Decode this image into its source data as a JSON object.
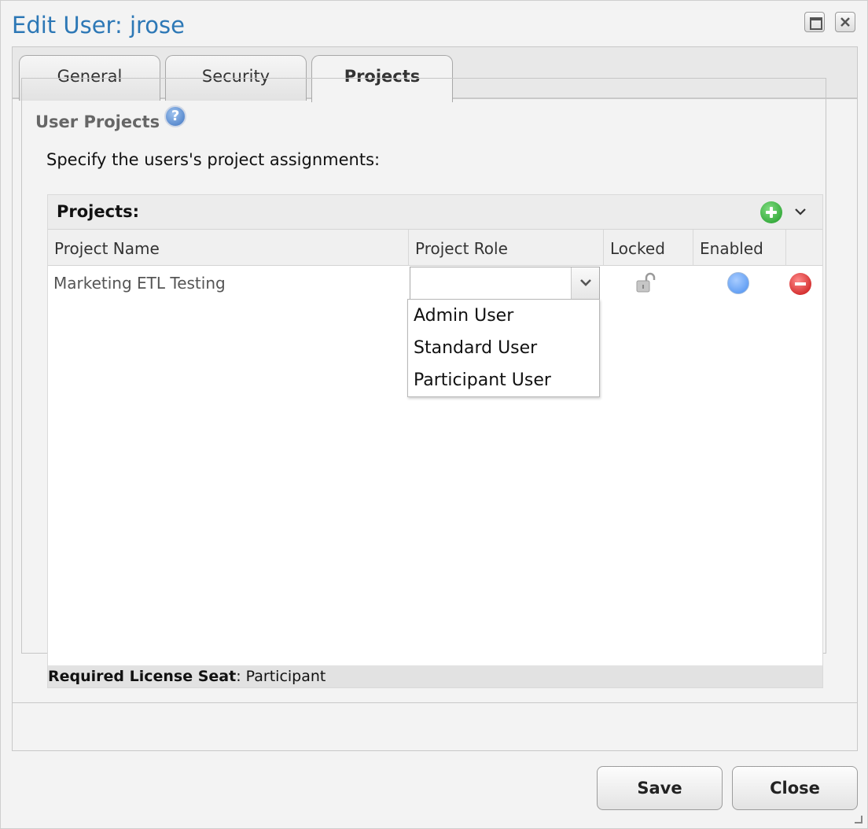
{
  "window": {
    "title": "Edit User: jrose"
  },
  "tabs": [
    {
      "label": "General",
      "active": false
    },
    {
      "label": "Security",
      "active": false
    },
    {
      "label": "Projects",
      "active": true
    }
  ],
  "user_projects": {
    "legend": "User Projects",
    "help_glyph": "?",
    "instructions": "Specify the users's project assignments:"
  },
  "grid": {
    "title": "Projects:",
    "columns": [
      "Project Name",
      "Project Role",
      "Locked",
      "Enabled"
    ],
    "rows": [
      {
        "project_name": "Marketing ETL Testing",
        "project_role": "",
        "locked": false,
        "enabled": true
      }
    ],
    "role_options": [
      "Admin User",
      "Standard User",
      "Participant User"
    ],
    "license_label": "Required License Seat",
    "license_value": ": Participant"
  },
  "buttons": {
    "save": "Save",
    "close": "Close"
  },
  "colors": {
    "title": "#2d78b6",
    "add": "#1e9a27",
    "remove": "#c40f0f",
    "enabled": "#4a8ff0"
  }
}
